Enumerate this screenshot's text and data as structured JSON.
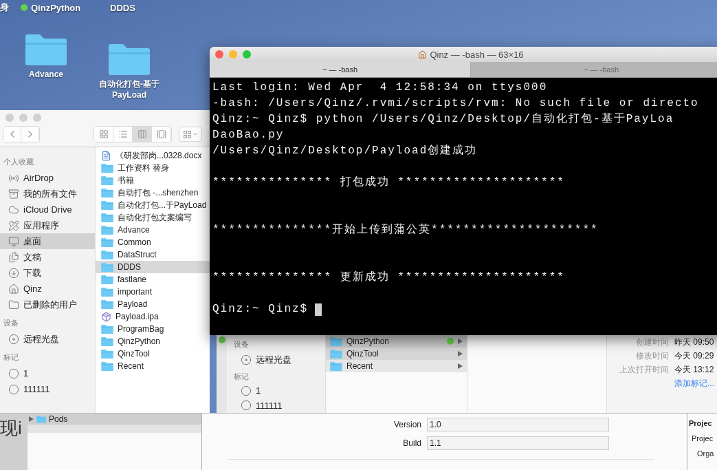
{
  "desktop": {
    "labels": [
      {
        "text": "身",
        "tagged": false
      },
      {
        "text": "QinzPython",
        "tagged": true
      },
      {
        "text": "DDDS",
        "tagged": false
      }
    ],
    "icons": [
      {
        "label": "Advance"
      },
      {
        "label": "自动化打包-基于 PayLoad"
      }
    ]
  },
  "finder": {
    "view_modes": [
      {
        "kind": "icons",
        "selected": false
      },
      {
        "kind": "list",
        "selected": false
      },
      {
        "kind": "columns",
        "selected": true
      },
      {
        "kind": "gallery",
        "selected": false
      }
    ],
    "sidebar": [
      {
        "heading": "个人收藏",
        "items": [
          {
            "label": "AirDrop",
            "kind": "airdrop",
            "selected": false
          },
          {
            "label": "我的所有文件",
            "kind": "files",
            "selected": false
          },
          {
            "label": "iCloud Drive",
            "kind": "cloud",
            "selected": false
          },
          {
            "label": "应用程序",
            "kind": "apps",
            "selected": false
          },
          {
            "label": "桌面",
            "kind": "desktop",
            "selected": true
          },
          {
            "label": "文稿",
            "kind": "docs",
            "selected": false
          },
          {
            "label": "下载",
            "kind": "download",
            "selected": false
          },
          {
            "label": "Qinz",
            "kind": "home",
            "selected": false
          },
          {
            "label": "已删除的用户",
            "kind": "folder",
            "selected": false
          }
        ]
      },
      {
        "heading": "设备",
        "items": [
          {
            "label": "远程光盘",
            "kind": "disc",
            "selected": false
          }
        ]
      },
      {
        "heading": "标记",
        "items": [
          {
            "label": "1",
            "kind": "tag",
            "selected": false
          },
          {
            "label": "111111",
            "kind": "tag",
            "selected": false
          }
        ]
      }
    ],
    "files": [
      {
        "name": "《研发部岗...0328.docx",
        "kind": "doc",
        "selected": false
      },
      {
        "name": "工作资料 替身",
        "kind": "alias",
        "selected": false
      },
      {
        "name": "书籍",
        "kind": "folder",
        "selected": false
      },
      {
        "name": "自动打包 -...shenzhen",
        "kind": "folder",
        "selected": false
      },
      {
        "name": "自动化打包...于PayLoad",
        "kind": "folder",
        "selected": false
      },
      {
        "name": "自动化打包文案编写",
        "kind": "folder",
        "selected": false
      },
      {
        "name": "Advance",
        "kind": "folder",
        "selected": false
      },
      {
        "name": "Common",
        "kind": "folder",
        "selected": false
      },
      {
        "name": "DataStruct",
        "kind": "folder",
        "selected": false
      },
      {
        "name": "DDDS",
        "kind": "folder",
        "selected": true
      },
      {
        "name": "fastlane",
        "kind": "folder",
        "selected": false
      },
      {
        "name": "important",
        "kind": "folder",
        "selected": false
      },
      {
        "name": "Payload",
        "kind": "folder",
        "selected": false
      },
      {
        "name": "Payload.ipa",
        "kind": "package",
        "selected": false
      },
      {
        "name": "ProgramBag",
        "kind": "folder",
        "selected": false
      },
      {
        "name": "QinzPython",
        "kind": "folder",
        "selected": false
      },
      {
        "name": "QinzTool",
        "kind": "folder",
        "selected": false
      },
      {
        "name": "Recent",
        "kind": "folder",
        "selected": false
      }
    ]
  },
  "finder_behind": {
    "tagged": true,
    "sidebar": [
      {
        "heading": "设备",
        "items": [
          {
            "label": "远程光盘",
            "kind": "disc"
          }
        ]
      },
      {
        "heading": "标记",
        "items": [
          {
            "label": "1",
            "kind": "tag"
          },
          {
            "label": "111111",
            "kind": "tag"
          }
        ]
      }
    ],
    "column": [
      {
        "name": "QinzPython",
        "tagged": true
      },
      {
        "name": "QinzTool",
        "tagged": false
      },
      {
        "name": "Recent",
        "tagged": false
      }
    ],
    "info": [
      {
        "label": "创建时间",
        "value": "昨天 09:50"
      },
      {
        "label": "修改时间",
        "value": "今天 09:29"
      },
      {
        "label": "上次打开时间",
        "value": "今天 13:12"
      }
    ],
    "add_tags": "添加标记..."
  },
  "terminal": {
    "title": "Qinz — -bash — 63×16",
    "tabs": [
      {
        "label": "~ — -bash",
        "selected": true
      },
      {
        "label": "~ — -bash",
        "selected": false
      }
    ],
    "lines": [
      {
        "kind": "text",
        "text": "Last login: Wed Apr  4 12:58:34 on ttys000"
      },
      {
        "kind": "text",
        "text": "-bash: /Users/Qinz/.rvmi/scripts/rvm: No such file or directo"
      },
      {
        "kind": "text",
        "text": "Qinz:~ Qinz$ python /Users/Qinz/Desktop/自动化打包-基于PayLoa"
      },
      {
        "kind": "text",
        "text": "DaoBao.py"
      },
      {
        "kind": "text",
        "text": "/Users/Qinz/Desktop/Payload创建成功"
      },
      {
        "kind": "blank"
      },
      {
        "kind": "text",
        "text": "*************** 打包成功 *********************"
      },
      {
        "kind": "blank"
      },
      {
        "kind": "blank"
      },
      {
        "kind": "text",
        "text": "***************开始上传到蒲公英*********************"
      },
      {
        "kind": "blank"
      },
      {
        "kind": "blank"
      },
      {
        "kind": "text",
        "text": "*************** 更新成功 *********************"
      },
      {
        "kind": "blank"
      },
      {
        "kind": "prompt",
        "text": "Qinz:~ Qinz$"
      }
    ]
  },
  "xcode": {
    "side_text": "现i",
    "navigator": [
      {
        "name": "Pods",
        "expanded": false
      }
    ],
    "fields": [
      {
        "label": "Version",
        "value": "1.0"
      },
      {
        "label": "Build",
        "value": "1.1"
      }
    ],
    "inspector": [
      {
        "kind": "heading",
        "text": "Projec"
      },
      {
        "kind": "row",
        "text": "Projec"
      },
      {
        "kind": "row",
        "text": "Orga"
      }
    ]
  }
}
